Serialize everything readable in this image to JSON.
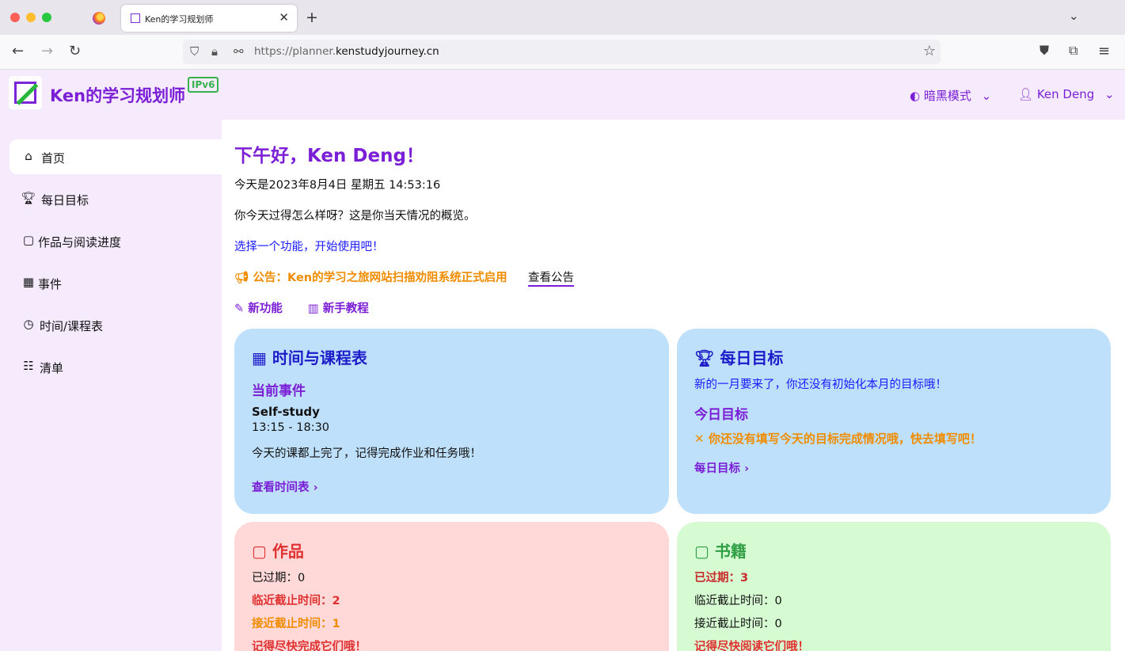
{
  "browser": {
    "tab_title": "Ken的学习规划师",
    "url_prefix": "https://planner.",
    "url_host": "kenstudyjourney.cn"
  },
  "header": {
    "app_title": "Ken的学习规划师",
    "badge": "IPv6",
    "dark_mode_label": "暗黑模式",
    "user_label": "Ken Deng"
  },
  "sidebar": {
    "items": [
      {
        "label": "首页",
        "icon": "home-icon"
      },
      {
        "label": "每日目标",
        "icon": "trophy-icon"
      },
      {
        "label": "作品与阅读进度",
        "icon": "note-icon"
      },
      {
        "label": "事件",
        "icon": "calendar-icon"
      },
      {
        "label": "时间/课程表",
        "icon": "clock-icon"
      },
      {
        "label": "清单",
        "icon": "checklist-icon"
      }
    ]
  },
  "main": {
    "greeting": "下午好，Ken Deng！",
    "datetime": "今天是2023年8月4日  星期五  14:53:16",
    "overview": "你今天过得怎么样呀？这是你当天情况的概览。",
    "choose_prompt": "选择一个功能，开始使用吧！",
    "notice": "公告：Ken的学习之旅网站扫描劝阻系统正式启用",
    "notice_link": "查看公告",
    "new_features": "新功能",
    "tutorial": "新手教程"
  },
  "schedule_card": {
    "title": "时间与课程表",
    "current_event_heading": "当前事件",
    "event_name": "Self-study",
    "event_time": "13:15 - 18:30",
    "message": "今天的课都上完了，记得完成作业和任务哦！",
    "link": "查看时间表"
  },
  "goals_card": {
    "title": "每日目标",
    "month_message": "新的一月要来了，你还没有初始化本月的目标哦！",
    "today_heading": "今日目标",
    "warning": "你还没有填写今天的目标完成情况哦，快去填写吧！",
    "link": "每日目标"
  },
  "works_card": {
    "title": "作品",
    "overdue": "已过期：0",
    "near_deadline": "临近截止时间：2",
    "approaching": "接近截止时间：1",
    "reminder": "记得尽快完成它们哦！"
  },
  "books_card": {
    "title": "书籍",
    "overdue": "已过期：3",
    "near_deadline": "临近截止时间：0",
    "approaching": "接近截止时间：0",
    "reminder": "记得尽快阅读它们哦！"
  },
  "colors": {
    "accent": "#7b1fd6",
    "header_bg": "#f5ebfd",
    "blue_card": "#bfe0fb",
    "red_card": "#ffd8d8",
    "green_card": "#d6fbd3",
    "warning": "#f08c00",
    "danger": "#e03131",
    "success": "#2f9e44"
  }
}
